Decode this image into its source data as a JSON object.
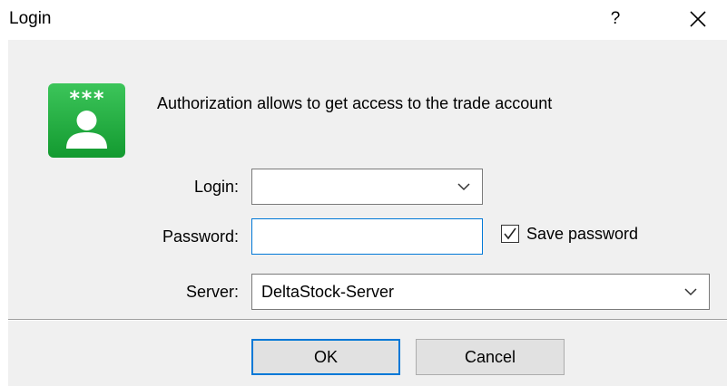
{
  "window": {
    "title": "Login",
    "help_label": "?",
    "close_icon": "close-icon"
  },
  "header": {
    "icon": "user-password-icon",
    "icon_stars": "***",
    "description": "Authorization allows to get access to the trade account"
  },
  "form": {
    "login": {
      "label": "Login:",
      "value": ""
    },
    "password": {
      "label": "Password:",
      "value": ""
    },
    "save_password": {
      "label": "Save password",
      "checked": true
    },
    "server": {
      "label": "Server:",
      "value": "DeltaStock-Server"
    }
  },
  "buttons": {
    "ok_label": "OK",
    "cancel_label": "Cancel"
  },
  "colors": {
    "accent": "#0078d7",
    "dialog_background": "#f0f0f0",
    "icon_green": "#1faf3c"
  }
}
